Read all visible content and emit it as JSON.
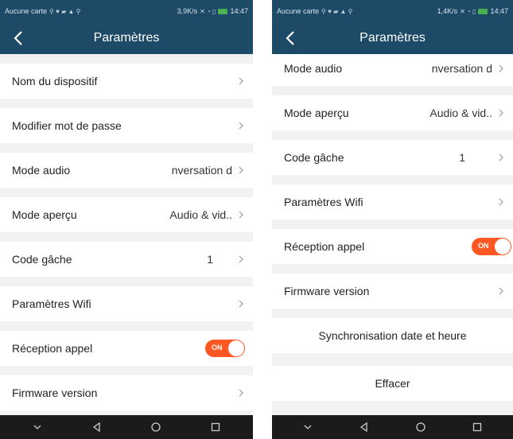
{
  "left": {
    "status": {
      "carrier": "Aucune carte",
      "speed": "3,9K/s",
      "time": "14:47"
    },
    "title": "Paramètres",
    "rows": {
      "nom": {
        "label": "Nom du dispositif"
      },
      "mdp": {
        "label": "Modifier mot de passe"
      },
      "audio": {
        "label": "Mode audio",
        "value": "nversation d"
      },
      "apercu": {
        "label": "Mode aperçu",
        "value": "Audio & vid.."
      },
      "gache": {
        "label": "Code gâche",
        "value": "1"
      },
      "wifi": {
        "label": "Paramètres Wifi"
      },
      "appel": {
        "label": "Réception appel",
        "toggle": "ON"
      },
      "firmware": {
        "label": "Firmware version"
      }
    }
  },
  "right": {
    "status": {
      "carrier": "Aucune carte",
      "speed": "1,4K/s",
      "time": "14:47"
    },
    "title": "Paramètres",
    "rows": {
      "audio": {
        "label": "Mode audio",
        "value": "nversation d"
      },
      "apercu": {
        "label": "Mode aperçu",
        "value": "Audio & vid.."
      },
      "gache": {
        "label": "Code gâche",
        "value": "1"
      },
      "wifi": {
        "label": "Paramètres Wifi"
      },
      "appel": {
        "label": "Réception appel",
        "toggle": "ON"
      },
      "firmware": {
        "label": "Firmware version"
      },
      "sync": {
        "label": "Synchronisation date et heure"
      },
      "effacer": {
        "label": "Effacer"
      }
    }
  },
  "colors": {
    "header": "#1c4a67",
    "toggle_on": "#ff5722",
    "navbar": "#1b1b1b",
    "background": "#f2f2f2"
  },
  "icons": [
    "back-arrow-icon",
    "chevron-right-icon",
    "nav-back-icon",
    "nav-home-icon",
    "nav-recents-icon",
    "nav-down-icon"
  ]
}
